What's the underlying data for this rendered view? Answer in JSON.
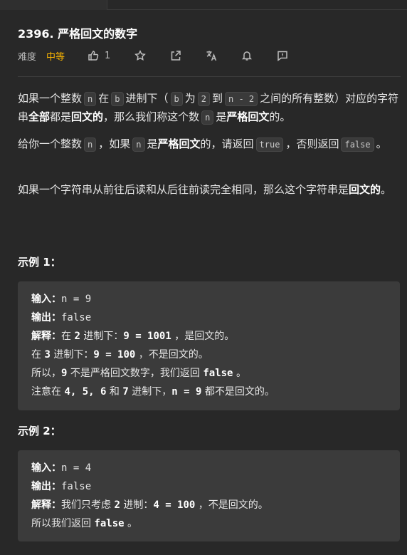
{
  "problem": {
    "title": "2396. 严格回文的数字",
    "difficulty_label": "难度",
    "difficulty_value": "中等",
    "like_count": "1",
    "colors": {
      "difficulty": "#ffb800",
      "background": "#282828",
      "code_bg": "#3b3b3b"
    },
    "icons": [
      "thumbs-up-icon",
      "star-icon",
      "share-icon",
      "translate-icon",
      "bell-icon",
      "feedback-icon"
    ]
  },
  "desc": {
    "p1": {
      "t1": "如果一个整数",
      "c_n": "n",
      "t2": "在",
      "c_b": "b",
      "t3": "进制下（",
      "c_b2": "b",
      "t4": "为",
      "c_2": "2",
      "t5": "到",
      "c_n2": "n - 2",
      "t6": "之间的所有整数）对应的字符串",
      "b1": "全部",
      "t7": "都是",
      "b2": "回文的",
      "t8": "，那么我们称这个数",
      "c_n3": "n",
      "t9": "是",
      "b3": "严格回文",
      "t10": "的。"
    },
    "p2": {
      "t1": "给你一个整数",
      "c_n": "n",
      "t2": "，如果",
      "c_n2": "n",
      "t3": "是",
      "b1": "严格回文",
      "t4": "的，请返回",
      "c_true": "true",
      "t5": "，否则返回",
      "c_false": "false",
      "t6": "。"
    },
    "p3": {
      "t1": "如果一个字符串从前往后读和从后往前读完全相同，那么这个字符串是",
      "b1": "回文的",
      "t2": "。"
    }
  },
  "example1": {
    "heading": "示例 1：",
    "input_label": "输入：",
    "input_value": "n = 9",
    "output_label": "输出：",
    "output_value": "false",
    "explain_label": "解释：",
    "l3_a": "在 ",
    "l3_b": "2",
    "l3_c": " 进制下：",
    "l3_d": "9 = 1001",
    "l3_e": " ，是回文的。",
    "l4_a": "在 ",
    "l4_b": "3",
    "l4_c": " 进制下：",
    "l4_d": "9 = 100",
    "l4_e": " ，不是回文的。",
    "l5_a": "所以，",
    "l5_b": "9",
    "l5_c": " 不是严格回文数字，我们返回 ",
    "l5_d": "false",
    "l5_e": " 。",
    "l6_a": "注意在 ",
    "l6_b": "4, 5, 6",
    "l6_c": " 和 ",
    "l6_d": "7",
    "l6_e": " 进制下，",
    "l6_f": "n = 9",
    "l6_g": " 都不是回文的。"
  },
  "example2": {
    "heading": "示例 2：",
    "input_label": "输入：",
    "input_value": "n = 4",
    "output_label": "输出：",
    "output_value": "false",
    "explain_label": "解释：",
    "l3_a": "我们只考虑 ",
    "l3_b": "2",
    "l3_c": " 进制：",
    "l3_d": "4 = 100",
    "l3_e": " ，不是回文的。",
    "l4_a": "所以我们返回 ",
    "l4_b": "false",
    "l4_c": " 。"
  }
}
